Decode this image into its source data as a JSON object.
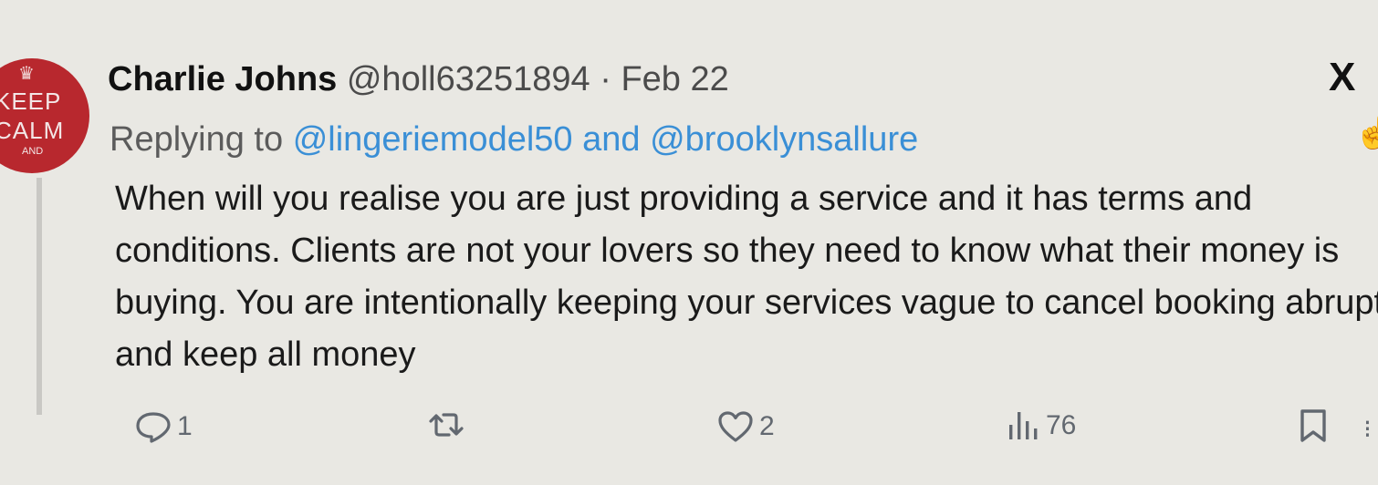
{
  "tweet": {
    "author_name": "Charlie Johns",
    "handle": "@holl63251894",
    "separator": "·",
    "date": "Feb 22",
    "replying_prefix": "Replying to",
    "mention_1": "@lingeriemodel50",
    "and_word": "and",
    "mention_2": "@brooklynsallure",
    "body": "When will you realise you are just providing a service and it has terms and conditions. Clients are not your lovers so they need to know what their money is buying. You are intentionally keeping your services vague to cancel booking abruptly and keep all money"
  },
  "avatar": {
    "line1": "KEEP",
    "line2": "CALM",
    "line3": "AND"
  },
  "logo": {
    "icon": "x-logo",
    "text": "X"
  },
  "actions": {
    "reply_count": "1",
    "retweet_count": "",
    "like_count": "2",
    "views_count": "76"
  },
  "colors": {
    "mention": "#3a8fd6",
    "avatar_bg": "#b8282e",
    "icon": "#626870"
  }
}
